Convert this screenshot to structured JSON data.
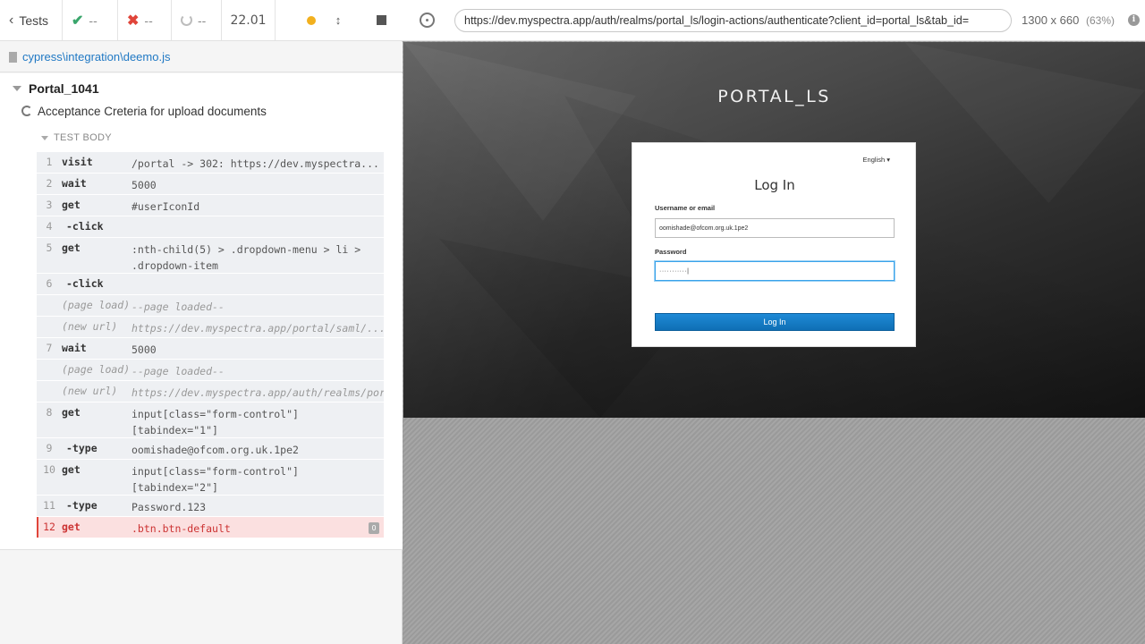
{
  "header": {
    "tests_label": "Tests",
    "passed": "--",
    "failed": "--",
    "pending": "--",
    "duration": "22.01"
  },
  "spec": {
    "path": "cypress\\integration\\deemo.js"
  },
  "suite": {
    "title": "Portal_1041"
  },
  "test": {
    "title": "Acceptance Creteria for upload documents",
    "body_label": "TEST BODY"
  },
  "commands": [
    {
      "num": "1",
      "name": "visit",
      "msg": "/portal -> 302: https://dev.myspectra...",
      "type": "cmd"
    },
    {
      "num": "2",
      "name": "wait",
      "msg": "5000",
      "type": "cmd"
    },
    {
      "num": "3",
      "name": "get",
      "msg": "#userIconId",
      "type": "cmd"
    },
    {
      "num": "4",
      "name": "-click",
      "msg": "",
      "type": "child"
    },
    {
      "num": "5",
      "name": "get",
      "msg": ":nth-child(5) > .dropdown-menu > li >\n.dropdown-item",
      "type": "cmd"
    },
    {
      "num": "6",
      "name": "-click",
      "msg": "",
      "type": "child"
    },
    {
      "num": "",
      "name": "(page load)",
      "msg": "--page loaded--",
      "type": "event"
    },
    {
      "num": "",
      "name": "(new url)",
      "msg": "https://dev.myspectra.app/portal/saml/...",
      "type": "event"
    },
    {
      "num": "7",
      "name": "wait",
      "msg": "5000",
      "type": "cmd"
    },
    {
      "num": "",
      "name": "(page load)",
      "msg": "--page loaded--",
      "type": "event"
    },
    {
      "num": "",
      "name": "(new url)",
      "msg": "https://dev.myspectra.app/auth/realms/portal_ls/login...",
      "type": "event"
    },
    {
      "num": "8",
      "name": "get",
      "msg": "input[class=\"form-control\"]\n[tabindex=\"1\"]",
      "type": "cmd"
    },
    {
      "num": "9",
      "name": "-type",
      "msg": "oomishade@ofcom.org.uk.1pe2",
      "type": "child"
    },
    {
      "num": "10",
      "name": "get",
      "msg": "input[class=\"form-control\"]\n[tabindex=\"2\"]",
      "type": "cmd"
    },
    {
      "num": "11",
      "name": "-type",
      "msg": "Password.123",
      "type": "child"
    },
    {
      "num": "12",
      "name": "get",
      "msg": ".btn.btn-default",
      "type": "failed",
      "badge": "0"
    }
  ],
  "aut": {
    "url": "https://dev.myspectra.app/auth/realms/portal_ls/login-actions/authenticate?client_id=portal_ls&tab_id=",
    "viewport": "1300 x 660",
    "scale": "(63%)",
    "info_glyph": "i"
  },
  "login_page": {
    "brand": "PORTAL_LS",
    "language": "English ▾",
    "title": "Log In",
    "username_label": "Username or email",
    "username_value": "oomishade@ofcom.org.uk.1pe2",
    "password_label": "Password",
    "password_value": "···········|",
    "submit_label": "Log In"
  },
  "colors": {
    "accent": "#2179c4",
    "pass": "#3aa66c",
    "fail": "#e0453a",
    "running": "#f2b01e",
    "login_button": "#1479c4"
  }
}
